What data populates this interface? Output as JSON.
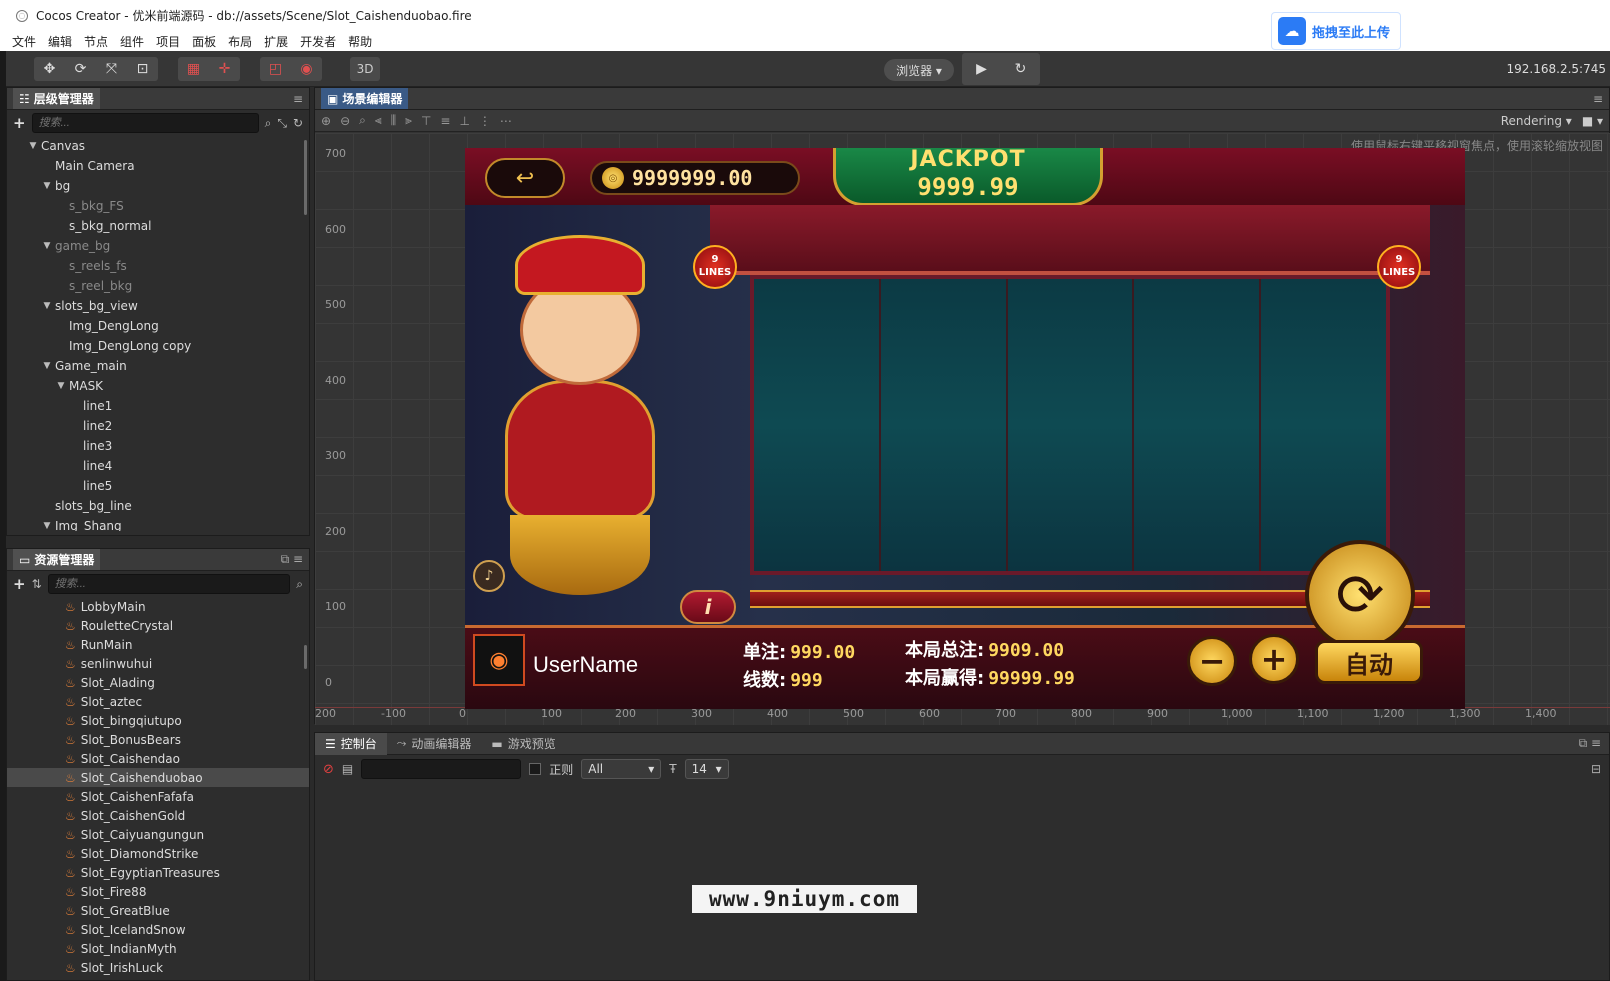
{
  "window": {
    "title": "Cocos Creator - 优米前端源码 - db://assets/Scene/Slot_Caishenduobao.fire"
  },
  "upload_badge": {
    "label": "拖拽至此上传"
  },
  "menu": [
    "文件",
    "编辑",
    "节点",
    "组件",
    "项目",
    "面板",
    "布局",
    "扩展",
    "开发者",
    "帮助"
  ],
  "toolbar": {
    "three_d": "3D",
    "preview_target": "浏览器 ▾",
    "ip": "192.168.2.5:745"
  },
  "hierarchy": {
    "title": "层级管理器",
    "search_placeholder": "搜索...",
    "nodes": [
      {
        "label": "Canvas",
        "expanded": true
      },
      {
        "label": "Main Camera"
      },
      {
        "label": "bg",
        "expanded": true
      },
      {
        "label": "s_bkg_FS",
        "dim": true
      },
      {
        "label": "s_bkg_normal"
      },
      {
        "label": "game_bg",
        "expanded": true,
        "dim": true
      },
      {
        "label": "s_reels_fs",
        "dim": true
      },
      {
        "label": "s_reel_bkg",
        "dim": true
      },
      {
        "label": "slots_bg_view",
        "expanded": true
      },
      {
        "label": "Img_DengLong"
      },
      {
        "label": "Img_DengLong copy"
      },
      {
        "label": "Game_main",
        "expanded": true
      },
      {
        "label": "MASK",
        "expanded": true
      },
      {
        "label": "line1"
      },
      {
        "label": "line2"
      },
      {
        "label": "line3"
      },
      {
        "label": "line4"
      },
      {
        "label": "line5"
      },
      {
        "label": "slots_bg_line"
      },
      {
        "label": "Img_Shang",
        "expanded": true
      }
    ]
  },
  "assets": {
    "title": "资源管理器",
    "search_placeholder": "搜索...",
    "items": [
      "LobbyMain",
      "RouletteCrystal",
      "RunMain",
      "senlinwuhui",
      "Slot_Alading",
      "Slot_aztec",
      "Slot_bingqiutupo",
      "Slot_BonusBears",
      "Slot_Caishendao",
      "Slot_Caishenduobao",
      "Slot_CaishenFafafa",
      "Slot_CaishenGold",
      "Slot_Caiyuangungun",
      "Slot_DiamondStrike",
      "Slot_EgyptianTreasures",
      "Slot_Fire88",
      "Slot_GreatBlue",
      "Slot_IcelandSnow",
      "Slot_IndianMyth",
      "Slot_IrishLuck"
    ],
    "selected": "Slot_Caishenduobao"
  },
  "scene": {
    "title": "场景编辑器",
    "rendering": "Rendering",
    "hint": "使用鼠标右键平移视窗焦点，使用滚轮缩放视图",
    "y_ticks": [
      "700",
      "600",
      "500",
      "400",
      "300",
      "200",
      "100",
      "0"
    ],
    "x_ticks": [
      "200",
      "-100",
      "0",
      "100",
      "200",
      "300",
      "400",
      "500",
      "600",
      "700",
      "800",
      "900",
      "1,000",
      "1,100",
      "1,200",
      "1,300",
      "1,400"
    ]
  },
  "game": {
    "coins": "9999999.00",
    "jackpot_title": "JACKPOT",
    "jackpot_value": "9999.99",
    "lines_badge_num": "9",
    "lines_badge_label": "LINES",
    "username": "UserName",
    "bet_label": "单注:",
    "bet_value": "999.00",
    "lines_label": "线数:",
    "lines_value": "999",
    "total_bet_label": "本局总注:",
    "total_bet_value": "9909.00",
    "total_win_label": "本局赢得:",
    "total_win_value": "99999.99",
    "auto_label": "自动",
    "info_label": "i"
  },
  "console": {
    "tabs": [
      "控制台",
      "动画编辑器",
      "游戏预览"
    ],
    "regex_label": "正则",
    "level": "All",
    "font_size": "14"
  },
  "watermark": "www.9niuym.com"
}
